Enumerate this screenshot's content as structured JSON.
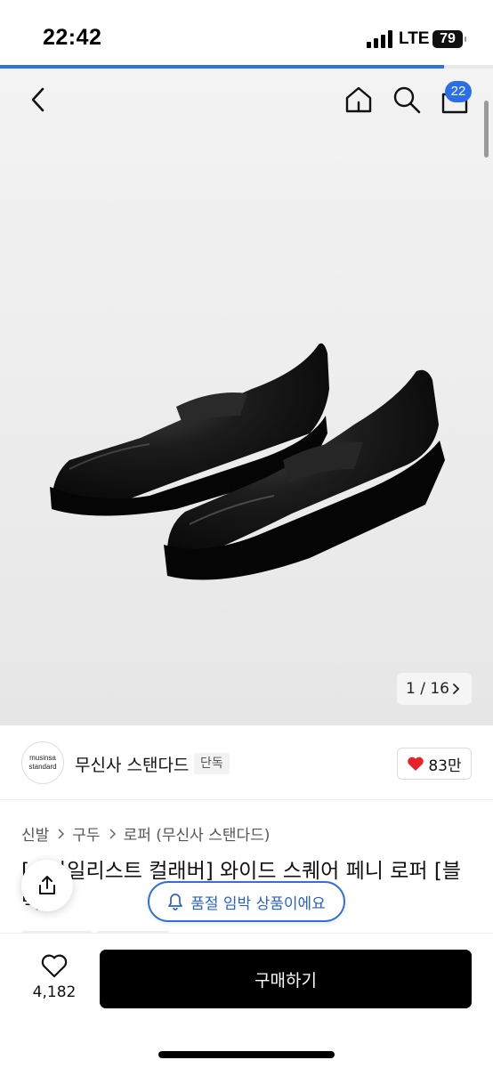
{
  "status_bar": {
    "time": "22:42",
    "network": "LTE",
    "battery": "79",
    "page_load_progress": 0.9
  },
  "nav": {
    "cart_count": "22"
  },
  "gallery": {
    "counter": "1 / 16"
  },
  "brand": {
    "logo_line1": "musinsa",
    "logo_line2": "standard",
    "name": "무신사 스탠다드",
    "badge": "단독",
    "likes": "83만"
  },
  "breadcrumb": [
    "신발",
    "구두",
    "로퍼 (무신사 스탠다드)"
  ],
  "product": {
    "title": "[스타일리스트 컬래버] 와이드 스퀘어 페니 로퍼 [블랙]"
  },
  "stock_notice": "품절 임박 상품이에요",
  "bottom": {
    "wish_count": "4,182",
    "buy_label": "구매하기"
  },
  "colors": {
    "accent": "#2a6fe6",
    "heart": "#e8202a",
    "primary_button": "#000000"
  }
}
